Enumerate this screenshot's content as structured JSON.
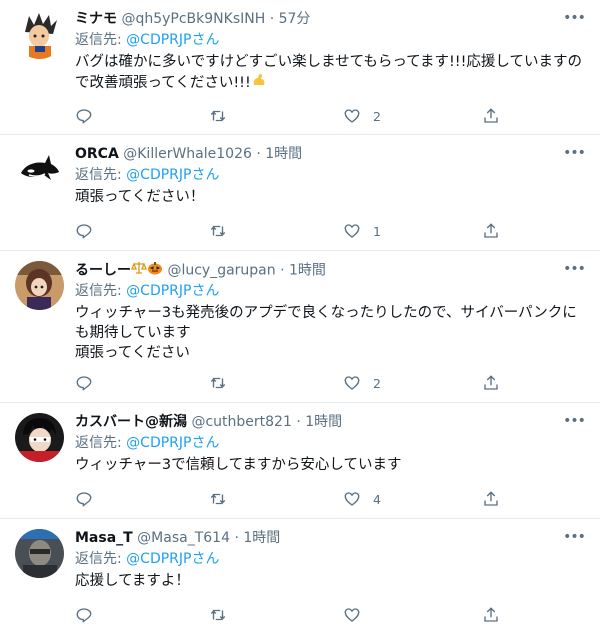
{
  "reply_prefix": "返信先:",
  "tweets": [
    {
      "name": "ミナモ",
      "handle": "@qh5yPcBk9NKsINH",
      "sep": "·",
      "time": "57分",
      "reply_to": "@CDPRJPさん",
      "body": "バグは確かに多いですけどすごい楽しませてもらってます!!!応援していますので改善頑張ってください!!!",
      "like_count": "2",
      "avatar_icon": "anime-warrior-avatar-icon"
    },
    {
      "name": "ORCA",
      "handle": "@KillerWhale1026",
      "sep": "·",
      "time": "1時間",
      "reply_to": "@CDPRJPさん",
      "body": "頑張ってください！",
      "like_count": "1",
      "avatar_icon": "orca-avatar-icon"
    },
    {
      "name": "るーしー",
      "handle": "@lucy_garupan",
      "sep": "·",
      "time": "1時間",
      "reply_to": "@CDPRJPさん",
      "body": "ウィッチャー3も発売後のアプデで良くなったりしたので、サイバーパンクにも期待しています\n頑張ってください",
      "like_count": "2",
      "avatar_icon": "figure-avatar-icon"
    },
    {
      "name": "カスバート@新潟",
      "handle": "@cuthbert821",
      "sep": "·",
      "time": "1時間",
      "reply_to": "@CDPRJPさん",
      "body": "ウィッチャー3で信頼してますから安心しています",
      "like_count": "4",
      "avatar_icon": "masked-hero-avatar-icon"
    },
    {
      "name": "Masa_T",
      "handle": "@Masa_T614",
      "sep": "·",
      "time": "1時間",
      "reply_to": "@CDPRJPさん",
      "body": "応援してますよ！",
      "like_count": "",
      "avatar_icon": "portrait-avatar-icon"
    }
  ],
  "colors": {
    "accent": "#1da1f2",
    "secondary": "#5b7083",
    "divider": "#e6ecf0"
  }
}
